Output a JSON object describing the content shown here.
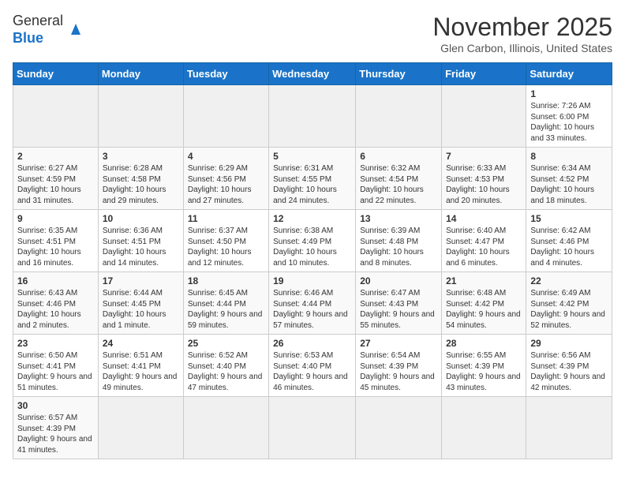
{
  "header": {
    "logo_general": "General",
    "logo_blue": "Blue",
    "month": "November 2025",
    "location": "Glen Carbon, Illinois, United States"
  },
  "weekdays": [
    "Sunday",
    "Monday",
    "Tuesday",
    "Wednesday",
    "Thursday",
    "Friday",
    "Saturday"
  ],
  "weeks": [
    [
      {
        "day": null,
        "info": null
      },
      {
        "day": null,
        "info": null
      },
      {
        "day": null,
        "info": null
      },
      {
        "day": null,
        "info": null
      },
      {
        "day": null,
        "info": null
      },
      {
        "day": null,
        "info": null
      },
      {
        "day": "1",
        "info": "Sunrise: 7:26 AM\nSunset: 6:00 PM\nDaylight: 10 hours and 33 minutes."
      }
    ],
    [
      {
        "day": "2",
        "info": "Sunrise: 6:27 AM\nSunset: 4:59 PM\nDaylight: 10 hours and 31 minutes."
      },
      {
        "day": "3",
        "info": "Sunrise: 6:28 AM\nSunset: 4:58 PM\nDaylight: 10 hours and 29 minutes."
      },
      {
        "day": "4",
        "info": "Sunrise: 6:29 AM\nSunset: 4:56 PM\nDaylight: 10 hours and 27 minutes."
      },
      {
        "day": "5",
        "info": "Sunrise: 6:31 AM\nSunset: 4:55 PM\nDaylight: 10 hours and 24 minutes."
      },
      {
        "day": "6",
        "info": "Sunrise: 6:32 AM\nSunset: 4:54 PM\nDaylight: 10 hours and 22 minutes."
      },
      {
        "day": "7",
        "info": "Sunrise: 6:33 AM\nSunset: 4:53 PM\nDaylight: 10 hours and 20 minutes."
      },
      {
        "day": "8",
        "info": "Sunrise: 6:34 AM\nSunset: 4:52 PM\nDaylight: 10 hours and 18 minutes."
      }
    ],
    [
      {
        "day": "9",
        "info": "Sunrise: 6:35 AM\nSunset: 4:51 PM\nDaylight: 10 hours and 16 minutes."
      },
      {
        "day": "10",
        "info": "Sunrise: 6:36 AM\nSunset: 4:51 PM\nDaylight: 10 hours and 14 minutes."
      },
      {
        "day": "11",
        "info": "Sunrise: 6:37 AM\nSunset: 4:50 PM\nDaylight: 10 hours and 12 minutes."
      },
      {
        "day": "12",
        "info": "Sunrise: 6:38 AM\nSunset: 4:49 PM\nDaylight: 10 hours and 10 minutes."
      },
      {
        "day": "13",
        "info": "Sunrise: 6:39 AM\nSunset: 4:48 PM\nDaylight: 10 hours and 8 minutes."
      },
      {
        "day": "14",
        "info": "Sunrise: 6:40 AM\nSunset: 4:47 PM\nDaylight: 10 hours and 6 minutes."
      },
      {
        "day": "15",
        "info": "Sunrise: 6:42 AM\nSunset: 4:46 PM\nDaylight: 10 hours and 4 minutes."
      }
    ],
    [
      {
        "day": "16",
        "info": "Sunrise: 6:43 AM\nSunset: 4:46 PM\nDaylight: 10 hours and 2 minutes."
      },
      {
        "day": "17",
        "info": "Sunrise: 6:44 AM\nSunset: 4:45 PM\nDaylight: 10 hours and 1 minute."
      },
      {
        "day": "18",
        "info": "Sunrise: 6:45 AM\nSunset: 4:44 PM\nDaylight: 9 hours and 59 minutes."
      },
      {
        "day": "19",
        "info": "Sunrise: 6:46 AM\nSunset: 4:44 PM\nDaylight: 9 hours and 57 minutes."
      },
      {
        "day": "20",
        "info": "Sunrise: 6:47 AM\nSunset: 4:43 PM\nDaylight: 9 hours and 55 minutes."
      },
      {
        "day": "21",
        "info": "Sunrise: 6:48 AM\nSunset: 4:42 PM\nDaylight: 9 hours and 54 minutes."
      },
      {
        "day": "22",
        "info": "Sunrise: 6:49 AM\nSunset: 4:42 PM\nDaylight: 9 hours and 52 minutes."
      }
    ],
    [
      {
        "day": "23",
        "info": "Sunrise: 6:50 AM\nSunset: 4:41 PM\nDaylight: 9 hours and 51 minutes."
      },
      {
        "day": "24",
        "info": "Sunrise: 6:51 AM\nSunset: 4:41 PM\nDaylight: 9 hours and 49 minutes."
      },
      {
        "day": "25",
        "info": "Sunrise: 6:52 AM\nSunset: 4:40 PM\nDaylight: 9 hours and 47 minutes."
      },
      {
        "day": "26",
        "info": "Sunrise: 6:53 AM\nSunset: 4:40 PM\nDaylight: 9 hours and 46 minutes."
      },
      {
        "day": "27",
        "info": "Sunrise: 6:54 AM\nSunset: 4:39 PM\nDaylight: 9 hours and 45 minutes."
      },
      {
        "day": "28",
        "info": "Sunrise: 6:55 AM\nSunset: 4:39 PM\nDaylight: 9 hours and 43 minutes."
      },
      {
        "day": "29",
        "info": "Sunrise: 6:56 AM\nSunset: 4:39 PM\nDaylight: 9 hours and 42 minutes."
      }
    ],
    [
      {
        "day": "30",
        "info": "Sunrise: 6:57 AM\nSunset: 4:39 PM\nDaylight: 9 hours and 41 minutes."
      },
      {
        "day": null,
        "info": null
      },
      {
        "day": null,
        "info": null
      },
      {
        "day": null,
        "info": null
      },
      {
        "day": null,
        "info": null
      },
      {
        "day": null,
        "info": null
      },
      {
        "day": null,
        "info": null
      }
    ]
  ]
}
